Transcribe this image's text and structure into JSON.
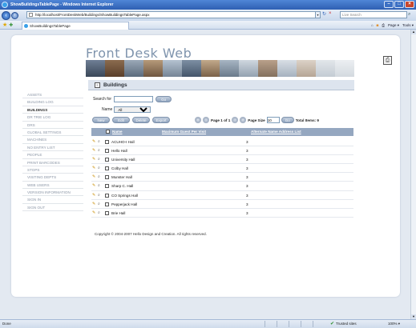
{
  "window": {
    "title": "ShowBuildingsTablePage - Windows Internet Explorer"
  },
  "browser": {
    "address": "http://localhost/FrontDeskWeb/Buildings/ShowBuildingsTablePage.aspx",
    "search_placeholder": "Live Search",
    "tab_title": "ShowBuildingsTablePage",
    "commands": [
      "Page ▾",
      "Tools ▾"
    ]
  },
  "brand": {
    "title": "Front   Desk   Web"
  },
  "sidebar": {
    "items": [
      {
        "label": "ASSETS"
      },
      {
        "label": "BUILDING LOG"
      },
      {
        "label": "BUILDINGS"
      },
      {
        "label": "DR TRIE LOG"
      },
      {
        "label": "DRS"
      },
      {
        "label": "GLOBAL SETTINGS"
      },
      {
        "label": "MACHINES"
      },
      {
        "label": "NO ENTRY LIST"
      },
      {
        "label": "PEOPLE"
      },
      {
        "label": "PRINT BARCODES"
      },
      {
        "label": "STOPS"
      },
      {
        "label": "VISITING DEPTS"
      },
      {
        "label": "WEB USERS"
      },
      {
        "label": "VERSION INFORMATION"
      },
      {
        "label": "SIGN IN"
      },
      {
        "label": "SIGN OUT"
      }
    ],
    "active_index": 2
  },
  "section": {
    "title": "Buildings"
  },
  "search": {
    "label": "Search for",
    "value": "",
    "go_label": "Go",
    "name_label": "Name",
    "name_selected": "All"
  },
  "actions": {
    "new": "New",
    "edit": "Edit",
    "delete": "Delete",
    "export": "Export"
  },
  "pager": {
    "page_text": "Page 1 of 1",
    "page_size_label": "Page Size",
    "page_size": "10",
    "go_label": "Go",
    "total_items": "Total Items: 9"
  },
  "table": {
    "headers": [
      "Name",
      "Maximum Guest Per Visit",
      "Alternate Name Address List"
    ],
    "rows": [
      {
        "name": "ACUHO-I Hall",
        "guests": "3"
      },
      {
        "name": "Hello Hall",
        "guests": "3"
      },
      {
        "name": "University Hall",
        "guests": "3"
      },
      {
        "name": "Colby Hall",
        "guests": "3"
      },
      {
        "name": "Munster Hall",
        "guests": "3"
      },
      {
        "name": "Sharp C. Hall",
        "guests": "3"
      },
      {
        "name": "CO Springs Hall",
        "guests": "3"
      },
      {
        "name": "Pepperjack Hall",
        "guests": "3"
      },
      {
        "name": "Brie Hall",
        "guests": "3"
      }
    ]
  },
  "footer": {
    "copyright": "Copyright © 2004-2007 Hello Design and Creation. All rights reserved."
  },
  "statusbar": {
    "left": "Done",
    "zone": "Trusted sites",
    "zoom": "100% ▾"
  },
  "colors": {
    "header_band": "#dde4ee",
    "grid_header": "#95a7c0",
    "brand_text": "#7f94ad"
  }
}
